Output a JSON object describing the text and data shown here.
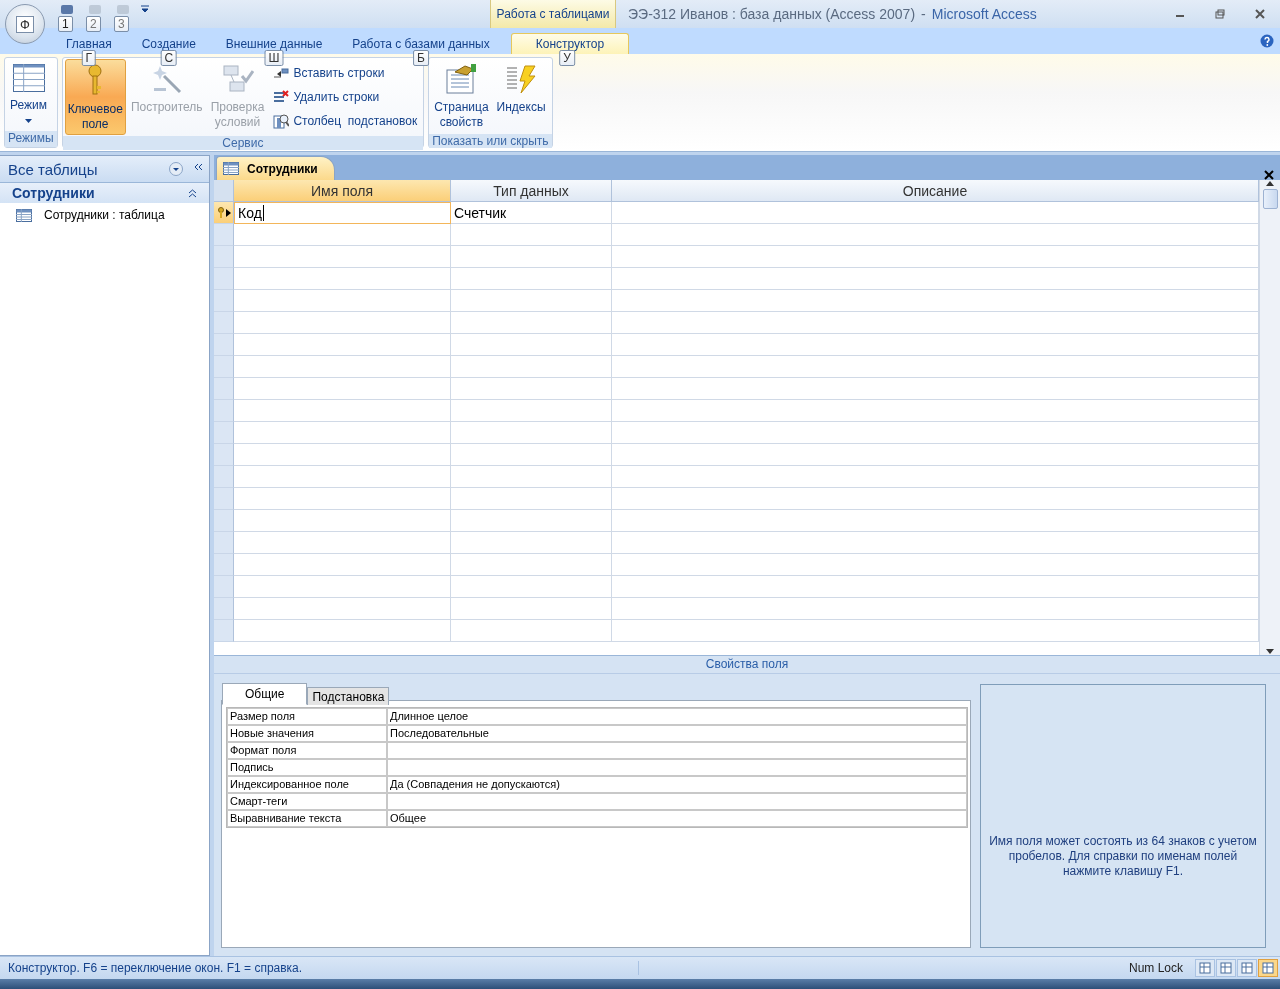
{
  "window": {
    "title": "ЭЭ-312 Иванов : база данных (Access 2007)",
    "separator": "-",
    "app": "Microsoft Access",
    "office_key": "Ф"
  },
  "quick_access": [
    {
      "key": "1",
      "disabled": false
    },
    {
      "key": "2",
      "disabled": true
    },
    {
      "key": "3",
      "disabled": true
    }
  ],
  "context_tab_group": "Работа с таблицами",
  "tabs": [
    {
      "label": "Главная",
      "key": "Г",
      "selected": false
    },
    {
      "label": "Создание",
      "key": "С",
      "selected": false
    },
    {
      "label": "Внешние данные",
      "key": "Ш",
      "selected": false
    },
    {
      "label": "Работа с базами данных",
      "key": "Б",
      "selected": false
    },
    {
      "label": "Конструктор",
      "key": "У",
      "selected": true
    }
  ],
  "ribbon": [
    {
      "title": "Режимы",
      "buttons": [
        {
          "kind": "large",
          "label": "Режим",
          "active": false,
          "disabled": false
        }
      ]
    },
    {
      "title": "Сервис",
      "buttons": [
        {
          "kind": "large",
          "label": "Ключевое\nполе",
          "active": true,
          "disabled": false
        },
        {
          "kind": "large",
          "label": "Построитель",
          "active": false,
          "disabled": true
        },
        {
          "kind": "large",
          "label": "Проверка\nусловий",
          "active": false,
          "disabled": true
        },
        {
          "kind": "small",
          "label": "Вставить строки",
          "disabled": false
        },
        {
          "kind": "small",
          "label": "Удалить строки",
          "disabled": false
        },
        {
          "kind": "small",
          "label": "Столбец  подстановок",
          "disabled": false
        }
      ]
    },
    {
      "title": "Показать или скрыть",
      "buttons": [
        {
          "kind": "large",
          "label": "Страница\nсвойств",
          "active": false,
          "disabled": false
        },
        {
          "kind": "large",
          "label": "Индексы",
          "active": false,
          "disabled": false
        }
      ]
    }
  ],
  "navigation": {
    "title": "Все таблицы",
    "groups": [
      {
        "title": "Сотрудники",
        "expanded": true,
        "items": [
          {
            "label": "Сотрудники : таблица",
            "selected": false
          }
        ]
      }
    ]
  },
  "document_tabs": [
    {
      "label": "Сотрудники",
      "selected": true
    }
  ],
  "grid": {
    "columns": [
      {
        "label": "Имя поля",
        "selected": true
      },
      {
        "label": "Тип данных",
        "selected": false
      },
      {
        "label": "Описание",
        "selected": false
      }
    ],
    "rows": [
      {
        "name": "Код",
        "type": "Счетчик",
        "primary_key": true,
        "current": true
      }
    ]
  },
  "properties": {
    "title": "Свойства поля",
    "tabs": [
      {
        "label": "Общие",
        "selected": true
      },
      {
        "label": "Подстановка",
        "selected": false
      }
    ],
    "rows": [
      {
        "label": "Размер поля",
        "value": "Длинное целое"
      },
      {
        "label": "Новые значения",
        "value": "Последовательные"
      },
      {
        "label": "Формат поля"
      },
      {
        "label": "Подпись"
      },
      {
        "label": "Индексированное поле",
        "value": "Да (Совпадения не допускаются)"
      },
      {
        "label": "Смарт-теги"
      },
      {
        "label": "Выравнивание текста",
        "value": "Общее"
      }
    ],
    "help": "Имя поля может состоять из 64 знаков с учетом пробелов.  Для справки по именам полей нажмите клавишу F1."
  },
  "status_bar": {
    "text": "Конструктор.  F6 = переключение окон.  F1 = справка.",
    "indicators": [
      "Num Lock"
    ],
    "views": [
      {
        "selected": false
      },
      {
        "selected": false
      },
      {
        "selected": false
      },
      {
        "selected": true
      }
    ]
  }
}
